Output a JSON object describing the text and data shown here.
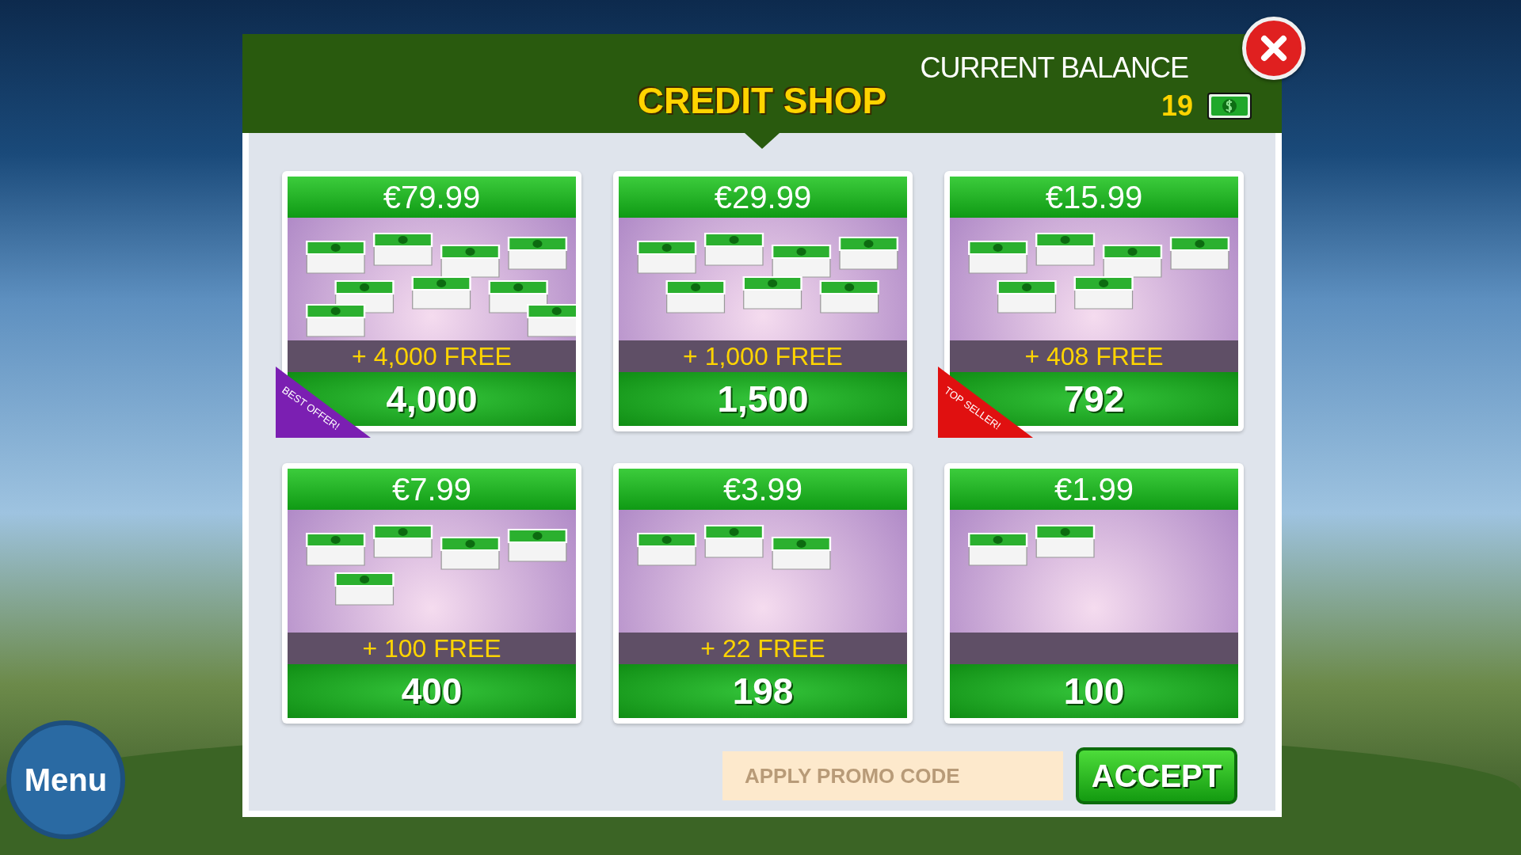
{
  "header": {
    "title": "CREDIT SHOP",
    "balance_label": "CURRENT BALANCE",
    "balance": "19"
  },
  "packs": [
    {
      "price": "€79.99",
      "bonus": "+ 4,000 FREE",
      "amount": "4,000",
      "ribbon": {
        "text": "BEST OFFER!",
        "color": "#7b1fb2"
      }
    },
    {
      "price": "€29.99",
      "bonus": "+ 1,000 FREE",
      "amount": "1,500"
    },
    {
      "price": "€15.99",
      "bonus": "+ 408 FREE",
      "amount": "792",
      "ribbon": {
        "text": "TOP SELLER!",
        "color": "#e01010"
      }
    },
    {
      "price": "€7.99",
      "bonus": "+ 100 FREE",
      "amount": "400"
    },
    {
      "price": "€3.99",
      "bonus": "+ 22 FREE",
      "amount": "198"
    },
    {
      "price": "€1.99",
      "amount": "100"
    }
  ],
  "promo": {
    "placeholder": "APPLY PROMO CODE"
  },
  "accept": "ACCEPT",
  "menu": "Menu"
}
